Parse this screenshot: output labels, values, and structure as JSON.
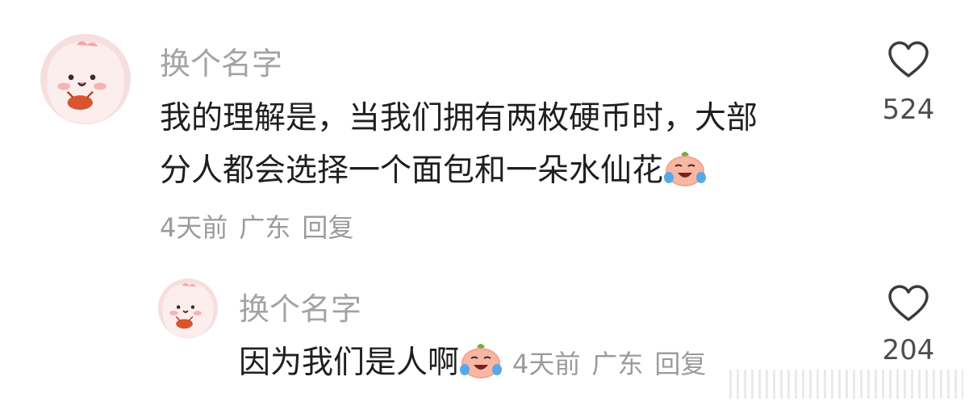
{
  "comment": {
    "author": "换个名字",
    "lines": [
      "我的理解是，当我们拥有两枚硬币时，大部",
      "分人都会选择一个面包和一朵水仙花"
    ],
    "meta": {
      "time": "4天前",
      "location": "广东",
      "reply": "回复"
    },
    "likes": "524"
  },
  "reply": {
    "author": "换个名字",
    "text": "因为我们是人啊",
    "meta": {
      "time": "4天前",
      "location": "广东",
      "reply": "回复"
    },
    "likes": "204"
  },
  "icons": {
    "like": "heart-outline-icon",
    "emoji": "crying-laughing-emoji-icon"
  },
  "colors": {
    "name": "#a3a3a3",
    "text": "#1f1f1f",
    "meta": "#9b9b9b",
    "avatar_bg": "#f6d6d6"
  }
}
